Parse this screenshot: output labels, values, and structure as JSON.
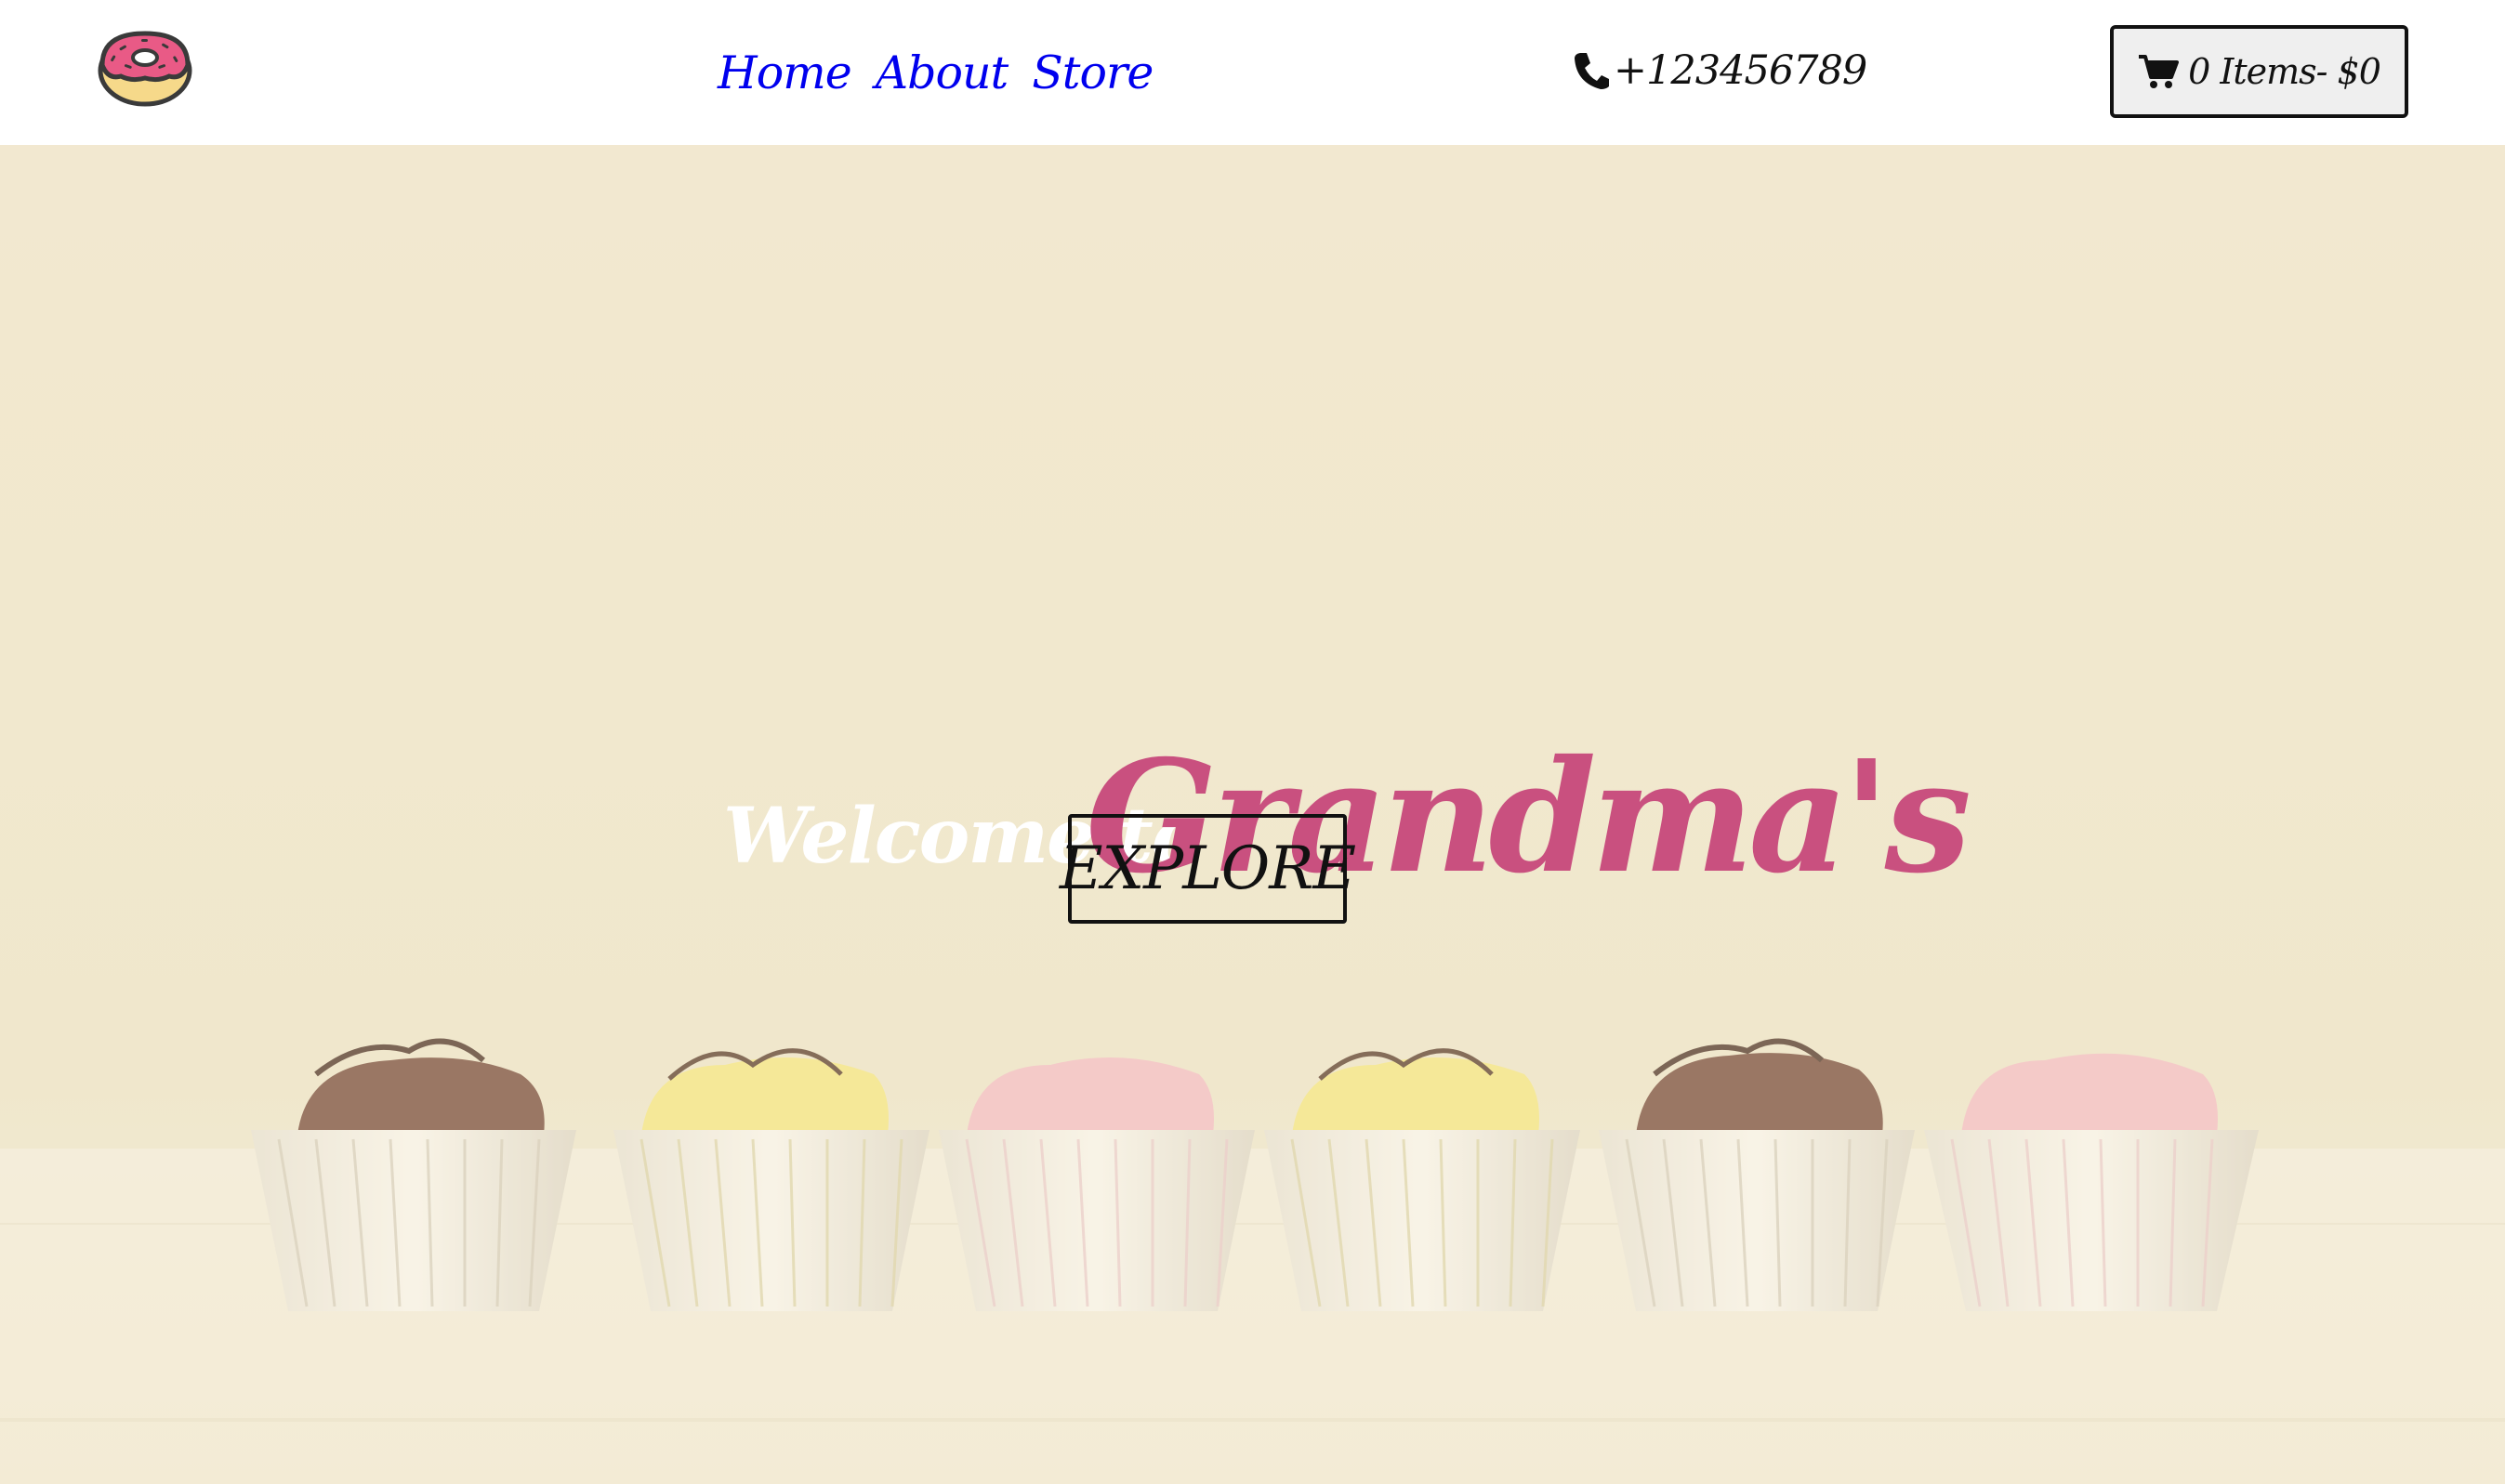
{
  "navbar": {
    "logo_icon": "donut-icon",
    "links": [
      {
        "label": "Home"
      },
      {
        "label": "About"
      },
      {
        "label": "Store"
      }
    ],
    "link_color": "#0000ee",
    "phone": {
      "icon": "phone-icon",
      "number": "+123456789"
    },
    "cart": {
      "icon": "shopping-cart-icon",
      "label": "0 Items- $0"
    }
  },
  "hero": {
    "welcome_text": "Welcome to",
    "brand_text": "Grandma's",
    "brand_color": "#c9507f",
    "explore_label": "EXPLORE",
    "background_image": "cupcakes-on-shelf"
  }
}
